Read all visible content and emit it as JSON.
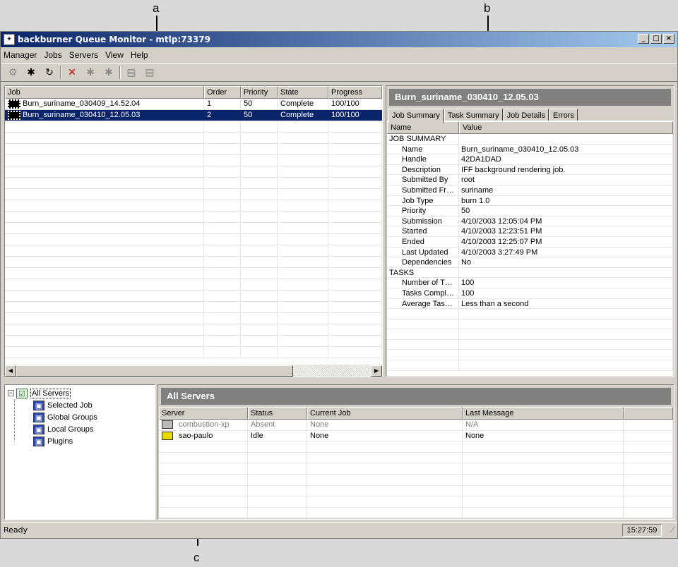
{
  "callouts": {
    "a": "a",
    "b": "b",
    "c": "c"
  },
  "window": {
    "title": "backburner Queue Monitor - mtlp:73379",
    "buttons": [
      "_",
      "□",
      "×"
    ]
  },
  "menu": [
    "Manager",
    "Jobs",
    "Servers",
    "View",
    "Help"
  ],
  "toolbar": [
    {
      "icon": "activate-job-icon",
      "glyph": "⚙",
      "disabled": true
    },
    {
      "icon": "deactivate-job-icon",
      "glyph": "✱",
      "disabled": false
    },
    {
      "icon": "refresh-icon",
      "glyph": "↻",
      "disabled": false
    },
    {
      "icon": "delete-job-icon",
      "glyph": "✕",
      "disabled": false
    },
    {
      "icon": "restart-job-icon",
      "glyph": "✱",
      "disabled": true
    },
    {
      "icon": "suspend-job-icon",
      "glyph": "✱",
      "disabled": true
    },
    {
      "icon": "server-icon",
      "glyph": "▤",
      "disabled": true
    },
    {
      "icon": "server-group-icon",
      "glyph": "▤",
      "disabled": true
    }
  ],
  "jobs": {
    "columns": [
      "Job",
      "Order",
      "Priority",
      "State",
      "Progress"
    ],
    "rows": [
      {
        "job": "Burn_suriname_030409_14.52.04",
        "order": "1",
        "priority": "50",
        "state": "Complete",
        "progress": "100/100",
        "selected": false
      },
      {
        "job": "Burn_suriname_030410_12.05.03",
        "order": "2",
        "priority": "50",
        "state": "Complete",
        "progress": "100/100",
        "selected": true
      }
    ]
  },
  "details": {
    "title": "Burn_suriname_030410_12.05.03",
    "tabs": [
      "Job Summary",
      "Task Summary",
      "Job Details",
      "Errors"
    ],
    "columns": [
      "Name",
      "Value"
    ],
    "rows": [
      {
        "name": "JOB SUMMARY",
        "value": "",
        "indent": false
      },
      {
        "name": "Name",
        "value": "Burn_suriname_030410_12.05.03",
        "indent": true
      },
      {
        "name": "Handle",
        "value": "42DA1DAD",
        "indent": true
      },
      {
        "name": "Description",
        "value": "IFF background rendering job.",
        "indent": true
      },
      {
        "name": "Submitted By",
        "value": "root",
        "indent": true
      },
      {
        "name": "Submitted Fr…",
        "value": "suriname",
        "indent": true
      },
      {
        "name": "Job Type",
        "value": "burn 1.0",
        "indent": true
      },
      {
        "name": "Priority",
        "value": "50",
        "indent": true
      },
      {
        "name": "Submission",
        "value": "4/10/2003 12:05:04 PM",
        "indent": true
      },
      {
        "name": "Started",
        "value": "4/10/2003 12:23:51 PM",
        "indent": true
      },
      {
        "name": "Ended",
        "value": "4/10/2003 12:25:07 PM",
        "indent": true
      },
      {
        "name": "Last Updated",
        "value": "4/10/2003 3:27:49 PM",
        "indent": true
      },
      {
        "name": "Dependencies",
        "value": "No",
        "indent": true
      },
      {
        "name": "TASKS",
        "value": "",
        "indent": false
      },
      {
        "name": "Number of T…",
        "value": "100",
        "indent": true
      },
      {
        "name": "Tasks Compl…",
        "value": "100",
        "indent": true
      },
      {
        "name": "Average Tas…",
        "value": "Less than a second",
        "indent": true
      }
    ]
  },
  "tree": {
    "root": "All Servers",
    "children": [
      "Selected Job",
      "Global Groups",
      "Local Groups",
      "Plugins"
    ]
  },
  "servers": {
    "title": "All Servers",
    "columns": [
      "Server",
      "Status",
      "Current Job",
      "Last Message"
    ],
    "rows": [
      {
        "server": "combustion-xp",
        "status": "Absent",
        "job": "None",
        "message": "N/A",
        "absent": true
      },
      {
        "server": "sao-paulo",
        "status": "Idle",
        "job": "None",
        "message": "None",
        "absent": false
      }
    ]
  },
  "status": {
    "text": "Ready",
    "clock": "15:27:59"
  }
}
